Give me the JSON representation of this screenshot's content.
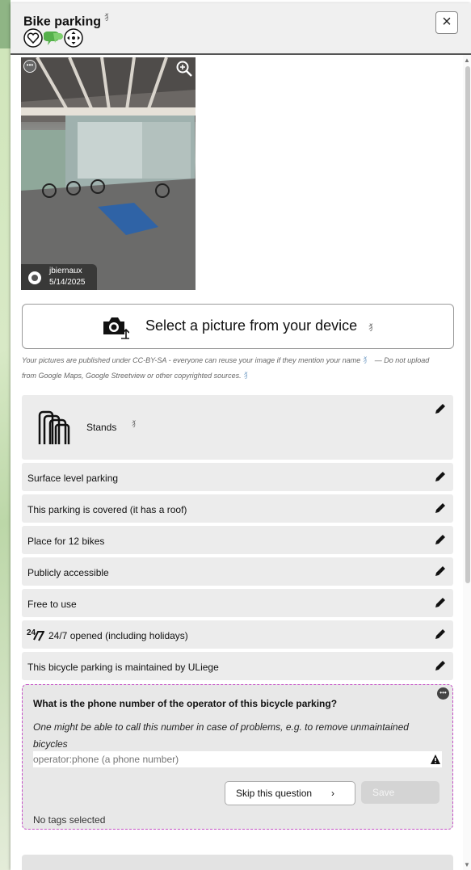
{
  "header": {
    "title": "Bike parking",
    "translate_mark": "⺨",
    "close_label": "×"
  },
  "photo": {
    "author": "jbiernaux",
    "date": "5/14/2025"
  },
  "upload": {
    "label": "Select a picture from your device",
    "translate_mark": "⺨",
    "license_text": "Your pictures are published under CC-BY-SA - everyone can reuse your image if they mention your name",
    "license_sep": "— Do not upload",
    "license_text2": "from Google Maps, Google Streetview or other copyrighted sources."
  },
  "attributes": [
    {
      "label": "Stands",
      "icon": "bike-stands-icon"
    },
    {
      "label": "Surface level parking"
    },
    {
      "label": "This parking is covered (it has a roof)"
    },
    {
      "label": "Place for 12 bikes"
    },
    {
      "label": "Publicly accessible"
    },
    {
      "label": "Free to use"
    },
    {
      "label": "24/7 opened (including holidays)",
      "icon": "24-7-icon"
    },
    {
      "label": "This bicycle parking is maintained by ULiege"
    }
  ],
  "question": {
    "title": "What is the phone number of the operator of this bicycle parking?",
    "description": "One might be able to call this number in case of problems, e.g. to remove unmaintained bicycles",
    "placeholder": "operator:phone (a phone number)",
    "skip_label": "Skip this question",
    "save_label": "Save",
    "tags_status": "No tags selected"
  },
  "colors": {
    "question_border": "#c54fc6",
    "row_bg": "#ececec",
    "save_disabled": "#d4d4d4"
  }
}
